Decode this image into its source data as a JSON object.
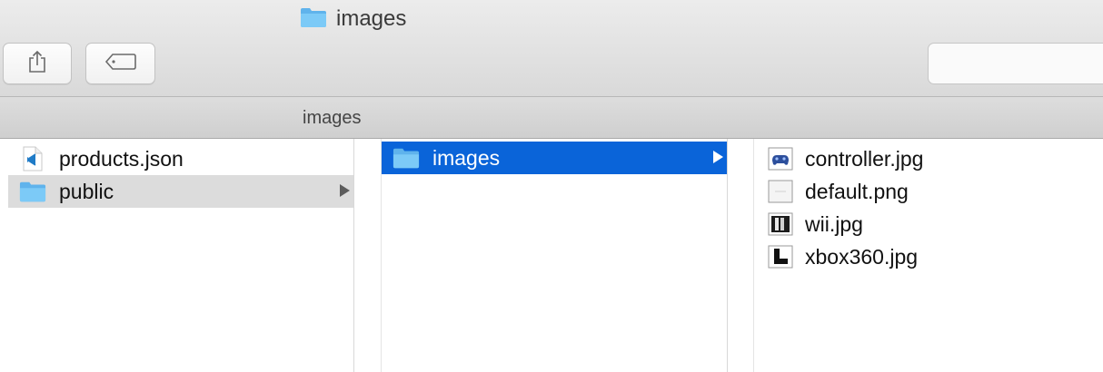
{
  "window": {
    "title": "images",
    "title_icon": "folder-icon"
  },
  "toolbar": {
    "share_icon": "share-icon",
    "tag_icon": "tag-icon",
    "search_placeholder": ""
  },
  "pathbar": {
    "label": "images"
  },
  "columns": [
    {
      "items": [
        {
          "name": "products.json",
          "icon": "vscode-file-icon",
          "selected": "none",
          "has_children": false
        },
        {
          "name": "public",
          "icon": "folder-icon",
          "selected": "inactive",
          "has_children": true
        }
      ]
    },
    {
      "items": [
        {
          "name": "images",
          "icon": "folder-icon",
          "selected": "active",
          "has_children": true
        }
      ]
    },
    {
      "items": [
        {
          "name": "controller.jpg",
          "icon": "image-thumbnail-icon",
          "selected": "none",
          "has_children": false
        },
        {
          "name": "default.png",
          "icon": "image-thumbnail-icon",
          "selected": "none",
          "has_children": false
        },
        {
          "name": "wii.jpg",
          "icon": "image-thumbnail-icon",
          "selected": "none",
          "has_children": false
        },
        {
          "name": "xbox360.jpg",
          "icon": "image-thumbnail-icon",
          "selected": "none",
          "has_children": false
        }
      ]
    }
  ],
  "colors": {
    "folder": "#6ec3f5",
    "selection_active": "#0a64d9",
    "selection_inactive": "#dcdcdc",
    "vscode_blue": "#1f7bc7"
  }
}
